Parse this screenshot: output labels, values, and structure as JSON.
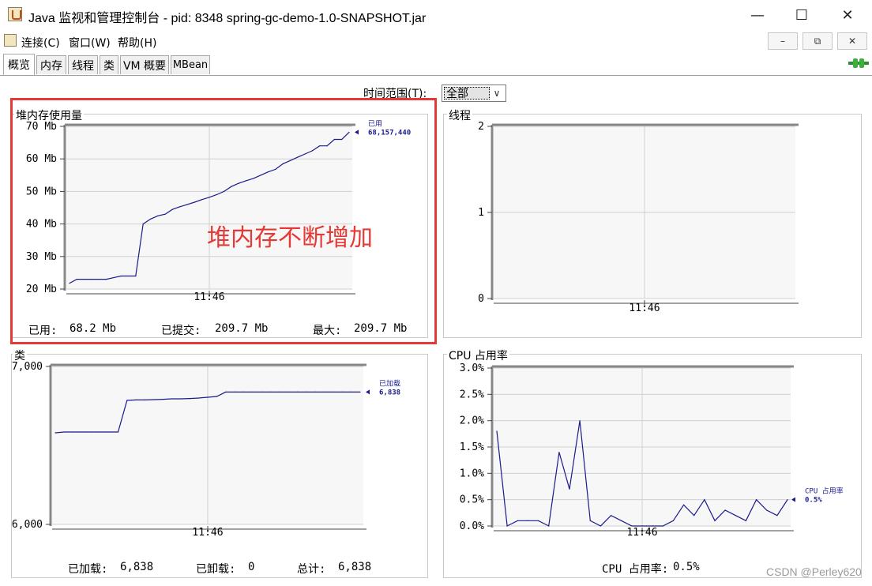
{
  "window": {
    "title": "Java 监视和管理控制台 - pid: 8348 spring-gc-demo-1.0-SNAPSHOT.jar",
    "minimize_glyph": "—",
    "maximize_glyph": "☐",
    "close_glyph": "✕"
  },
  "menu": {
    "items": [
      "连接(C)",
      "窗口(W)",
      "帮助(H)"
    ],
    "mdi_buttons": [
      "–",
      "⧉",
      "✕"
    ]
  },
  "tabs": [
    "概览",
    "内存",
    "线程",
    "类",
    "VM 概要",
    "MBean"
  ],
  "active_tab": "概览",
  "time_range": {
    "label": "时间范围(T):",
    "value": "全部"
  },
  "annotation": "堆内存不断增加",
  "watermark": "CSDN @Perley620",
  "panels": {
    "heap": {
      "title": "堆内存使用量",
      "legend_name": "已用",
      "legend_value": "68,157,440",
      "stats": {
        "used_label": "已用:",
        "used_value": "68.2  Mb",
        "committed_label": "已提交:",
        "committed_value": "209.7  Mb",
        "max_label": "最大:",
        "max_value": "209.7  Mb"
      }
    },
    "threads": {
      "title": "线程"
    },
    "classes": {
      "title": "类",
      "legend_name": "已加载",
      "legend_value": "6,838",
      "stats": {
        "loaded_label": "已加载:",
        "loaded_value": "6,838",
        "unloaded_label": "已卸载:",
        "unloaded_value": "0",
        "total_label": "总计:",
        "total_value": "6,838"
      }
    },
    "cpu": {
      "title": "CPU 占用率",
      "legend_name": "CPU 占用率",
      "legend_value": "0.5%",
      "stats": {
        "label": "CPU 占用率:",
        "value": "0.5%"
      }
    }
  },
  "chart_data": [
    {
      "id": "heap",
      "type": "line",
      "title": "堆内存使用量",
      "ylabel": "",
      "xlabel": "",
      "y_ticks": [
        "20 Mb",
        "30 Mb",
        "40 Mb",
        "50 Mb",
        "60 Mb",
        "70 Mb"
      ],
      "ylim": [
        20,
        70
      ],
      "x_ticks": [
        "11:46"
      ],
      "series": [
        {
          "name": "已用",
          "color": "#1a1a8c",
          "values": [
            21.8,
            23,
            23,
            23,
            23,
            23,
            23.5,
            24,
            24,
            24,
            40,
            41.5,
            42.5,
            43,
            44.5,
            45.3,
            46,
            46.7,
            47.5,
            48.2,
            49,
            50,
            51.5,
            52.5,
            53.3,
            54,
            55,
            56,
            56.8,
            58.5,
            59.5,
            60.5,
            61.5,
            62.5,
            64,
            64,
            66,
            66,
            68.2
          ]
        }
      ]
    },
    {
      "id": "threads",
      "type": "line",
      "title": "线程",
      "y_ticks": [
        "0",
        "1",
        "2"
      ],
      "ylim": [
        0,
        2
      ],
      "x_ticks": [
        "11:46"
      ],
      "series": []
    },
    {
      "id": "classes",
      "type": "line",
      "title": "类",
      "y_ticks": [
        "6,000",
        "7,000"
      ],
      "ylim": [
        6000,
        7000
      ],
      "x_ticks": [
        "11:46"
      ],
      "series": [
        {
          "name": "已加载",
          "color": "#1a1a8c",
          "values": [
            6580,
            6585,
            6585,
            6585,
            6585,
            6585,
            6585,
            6585,
            6785,
            6788,
            6788,
            6790,
            6792,
            6795,
            6795,
            6797,
            6800,
            6805,
            6810,
            6838,
            6838,
            6838,
            6838,
            6838,
            6838,
            6838,
            6838,
            6838,
            6838,
            6838,
            6838,
            6838,
            6838,
            6838,
            6838
          ]
        }
      ]
    },
    {
      "id": "cpu",
      "type": "line",
      "title": "CPU 占用率",
      "y_ticks": [
        "0.0%",
        "0.5%",
        "1.0%",
        "1.5%",
        "2.0%",
        "2.5%",
        "3.0%"
      ],
      "ylim": [
        0,
        3
      ],
      "x_ticks": [
        "11:46"
      ],
      "series": [
        {
          "name": "CPU 占用率",
          "color": "#1a1a8c",
          "values": [
            1.8,
            0.0,
            0.1,
            0.1,
            0.1,
            0.0,
            1.4,
            0.7,
            2.0,
            0.1,
            0.0,
            0.2,
            0.1,
            0.0,
            0.0,
            0.0,
            0.0,
            0.1,
            0.4,
            0.2,
            0.5,
            0.1,
            0.3,
            0.2,
            0.1,
            0.5,
            0.3,
            0.2,
            0.5
          ]
        }
      ]
    }
  ]
}
